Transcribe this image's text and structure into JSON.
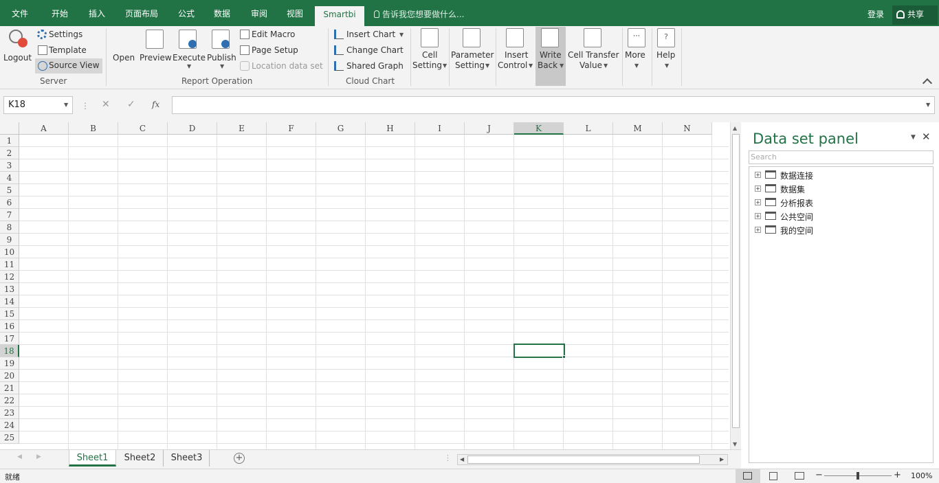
{
  "tabs": [
    "文件",
    "开始",
    "插入",
    "页面布局",
    "公式",
    "数据",
    "审阅",
    "视图",
    "Smartbi"
  ],
  "active_tab": "Smartbi",
  "tell_me": "告诉我您想要做什么...",
  "login": "登录",
  "share": "共享",
  "ribbon": {
    "logout": "Logout",
    "settings": "Settings",
    "template": "Template",
    "source_view": "Source View",
    "server_group": "Server",
    "open": "Open",
    "preview": "Preview",
    "execute": "Execute",
    "publish": "Publish",
    "edit_macro": "Edit Macro",
    "page_setup": "Page Setup",
    "location_data_set": "Location data set",
    "report_group": "Report Operation",
    "insert_chart": "Insert Chart",
    "change_chart": "Change Chart",
    "shared_graph": "Shared Graph",
    "cloud_group": "Cloud Chart",
    "cell_1": "Cell",
    "cell_2": "Setting",
    "param_1": "Parameter",
    "param_2": "Setting",
    "insert_1": "Insert",
    "insert_2": "Control",
    "write_1": "Write",
    "write_2": "Back",
    "transfer_1": "Cell Transfer",
    "transfer_2": "Value",
    "more": "More",
    "help": "Help"
  },
  "name_box": "K18",
  "fx": "fx",
  "columns": [
    "A",
    "B",
    "C",
    "D",
    "E",
    "F",
    "G",
    "H",
    "I",
    "J",
    "K",
    "L",
    "M",
    "N"
  ],
  "rows": [
    "1",
    "2",
    "3",
    "4",
    "5",
    "6",
    "7",
    "8",
    "9",
    "10",
    "11",
    "12",
    "13",
    "14",
    "15",
    "16",
    "17",
    "18",
    "19",
    "20",
    "21",
    "22",
    "23",
    "24",
    "25"
  ],
  "sheets": [
    "Sheet1",
    "Sheet2",
    "Sheet3"
  ],
  "active_sheet": "Sheet1",
  "status": "就绪",
  "zoom": "100%",
  "panel": {
    "title": "Data set panel",
    "search_placeholder": "Search",
    "items": [
      "数据连接",
      "数据集",
      "分析报表",
      "公共空间",
      "我的空间"
    ]
  },
  "colors": {
    "accent": "#217346"
  }
}
